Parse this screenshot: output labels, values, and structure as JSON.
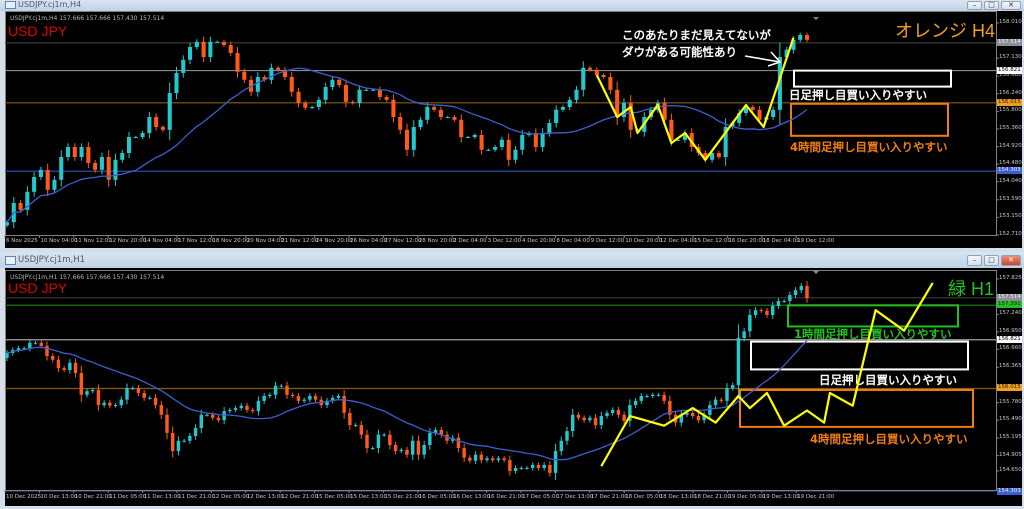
{
  "windows": [
    {
      "title": "USDJPY.cj1m,H4",
      "header": "USDJPY.cj1m,H4  157.666 157.666 157.430 157.514",
      "symbol_label": "USD JPY",
      "timeframe_label": "オレンジ H4",
      "controls": {
        "minimize": "–",
        "maximize": "□",
        "close": "✕"
      }
    },
    {
      "title": "USDJPY.cj1m,H1",
      "header": "USDJPY.cj1m,H1  157.666 157.666 157.430 157.514",
      "symbol_label": "USD JPY",
      "timeframe_label": "緑 H1",
      "controls": {
        "minimize": "–",
        "maximize": "□",
        "close": "✕"
      }
    }
  ],
  "colors": {
    "bull": "#22c8cc",
    "bear": "#ff5a1a",
    "ma": "#3b5fd0",
    "zigzag": "#ffff00",
    "orange": "#f07d10",
    "green": "#22c020",
    "white": "#ffffff",
    "symbol": "#e00000",
    "h4_label": "#f0a020",
    "h1_label": "#22c020"
  },
  "chart_data": [
    {
      "type": "candlestick",
      "title": "USD JPY",
      "timeframe": "H4",
      "ylim": [
        152.71,
        158.01
      ],
      "x_tick_labels": [
        "6 Nov 2025",
        "10 Nov 04:00",
        "11 Nov 12:00",
        "12 Nov 20:00",
        "14 Nov 04:00",
        "17 Nov 12:00",
        "18 Nov 20:00",
        "20 Nov 04:00",
        "21 Nov 12:00",
        "24 Nov 20:00",
        "26 Nov 04:00",
        "27 Nov 12:00",
        "28 Nov 20:00",
        "2 Dec 04:00",
        "3 Dec 12:00",
        "4 Dec 20:00",
        "8 Dec 04:00",
        "9 Dec 12:00",
        "10 Dec 20:00",
        "12 Dec 04:00",
        "15 Dec 12:00",
        "16 Dec 20:00",
        "18 Dec 04:00",
        "19 Dec 12:00"
      ],
      "y_tick_labels": [
        "158.010",
        "157.130",
        "156.680",
        "156.240",
        "155.800",
        "155.360",
        "154.920",
        "154.480",
        "154.040",
        "153.590",
        "153.150",
        "152.710"
      ],
      "price_markers": [
        {
          "price": 157.514,
          "label": "157.514",
          "color": "#8a8f99",
          "line": "#3a3a3a"
        },
        {
          "price": 156.821,
          "label": "156.821",
          "color": "#ffffff",
          "line": "#8a8a8a"
        },
        {
          "price": 156.015,
          "label": "156.015",
          "color": "#f0a020",
          "line": "#8a5a10"
        },
        {
          "price": 154.303,
          "label": "154.303",
          "color": "#3b5fd0",
          "line": "#2a4aa0"
        }
      ],
      "closes": [
        153.03,
        153.51,
        153.34,
        153.79,
        154.16,
        154.34,
        153.84,
        154.09,
        154.66,
        154.91,
        154.66,
        154.91,
        154.51,
        154.34,
        154.66,
        154.09,
        154.59,
        154.76,
        155.16,
        155.16,
        155.26,
        155.66,
        155.41,
        155.34,
        156.26,
        156.76,
        157.09,
        157.41,
        157.54,
        157.16,
        157.54,
        157.54,
        157.46,
        157.26,
        156.79,
        156.59,
        156.29,
        156.66,
        156.59,
        156.89,
        156.84,
        156.66,
        156.29,
        156.01,
        155.89,
        155.91,
        156.09,
        156.41,
        156.59,
        156.46,
        156.04,
        156.01,
        156.34,
        156.34,
        156.34,
        156.16,
        156.09,
        155.66,
        155.34,
        154.84,
        155.41,
        155.59,
        155.91,
        155.84,
        155.66,
        155.66,
        155.59,
        155.16,
        155.16,
        155.21,
        154.84,
        154.84,
        154.91,
        155.09,
        154.59,
        154.84,
        155.21,
        155.26,
        154.91,
        155.26,
        155.51,
        155.84,
        155.91,
        156.09,
        156.34,
        156.89,
        156.84,
        156.71,
        156.66,
        156.34,
        155.66,
        156.01,
        155.34,
        155.29,
        155.66,
        155.84,
        156.01,
        155.59,
        155.09,
        155.09,
        155.26,
        154.91,
        154.76,
        154.59,
        154.76,
        154.66,
        155.41,
        155.51,
        155.76,
        155.91,
        155.84,
        155.59,
        155.66,
        155.84,
        157.16,
        157.34,
        157.59,
        157.71,
        157.59
      ],
      "zigzag": [
        [
          87,
          156.71
        ],
        [
          90,
          155.66
        ],
        [
          92,
          155.91
        ],
        [
          93,
          155.26
        ],
        [
          96,
          155.96
        ],
        [
          98,
          155.01
        ],
        [
          100,
          155.26
        ],
        [
          103,
          154.59
        ],
        [
          109,
          155.96
        ],
        [
          111.6,
          155.41
        ],
        [
          116,
          157.64
        ]
      ],
      "zones": [
        {
          "label": "日足押し目買い入りやすい",
          "top": 156.82,
          "bottom": 156.42,
          "color": "#ffffff"
        },
        {
          "label": "4時間足押し目買い入りやすい",
          "top": 155.99,
          "bottom": 155.19,
          "color": "#f07d10"
        }
      ],
      "annotation": {
        "lines": [
          "このあたりまだ見えてないが",
          "ダウがある可能性あり"
        ]
      }
    },
    {
      "type": "candlestick",
      "title": "USD JPY",
      "timeframe": "H1",
      "ylim": [
        154.303,
        157.825
      ],
      "x_tick_labels": [
        "10 Dec 2025",
        "10 Dec 13:00",
        "10 Dec 21:00",
        "11 Dec 05:00",
        "11 Dec 13:00",
        "11 Dec 21:00",
        "12 Dec 05:00",
        "12 Dec 13:00",
        "12 Dec 21:00",
        "15 Dec 05:00",
        "15 Dec 13:00",
        "15 Dec 21:00",
        "16 Dec 05:00",
        "16 Dec 13:00",
        "16 Dec 21:00",
        "17 Dec 05:00",
        "17 Dec 13:00",
        "17 Dec 21:00",
        "18 Dec 05:00",
        "18 Dec 13:00",
        "18 Dec 21:00",
        "19 Dec 05:00",
        "19 Dec 13:00",
        "19 Dec 21:00"
      ],
      "y_tick_labels": [
        "157.825",
        "157.240",
        "156.950",
        "156.660",
        "156.365",
        "155.780",
        "155.490",
        "155.195",
        "154.905",
        "154.650"
      ],
      "price_markers": [
        {
          "price": 157.514,
          "label": "157.514",
          "color": "#8a8f99",
          "line": "#3a3a3a"
        },
        {
          "price": 157.391,
          "label": "157.391",
          "color": "#22c020",
          "line": "#1a7a1a"
        },
        {
          "price": 156.821,
          "label": "156.821",
          "color": "#ffffff",
          "line": "#a0a0a0"
        },
        {
          "price": 156.015,
          "label": "156.015",
          "color": "#f0a020",
          "line": "#8a5a10"
        },
        {
          "price": 154.303,
          "label": "154.303",
          "color": "#3b5fd0",
          "line": "#2a4aa0"
        }
      ],
      "closes": [
        156.6,
        156.65,
        156.68,
        156.68,
        156.77,
        156.77,
        156.72,
        156.55,
        156.49,
        156.35,
        156.32,
        156.44,
        156.27,
        155.91,
        155.97,
        155.99,
        155.74,
        155.78,
        155.73,
        155.74,
        155.83,
        156.02,
        156.02,
        155.94,
        155.86,
        155.86,
        155.74,
        155.58,
        155.28,
        154.98,
        155.15,
        155.15,
        155.23,
        155.36,
        155.58,
        155.58,
        155.53,
        155.49,
        155.64,
        155.66,
        155.69,
        155.73,
        155.66,
        155.64,
        155.81,
        155.89,
        155.91,
        156.06,
        156.06,
        155.91,
        155.89,
        155.81,
        155.83,
        155.89,
        155.83,
        155.74,
        155.81,
        155.86,
        155.89,
        155.61,
        155.41,
        155.41,
        155.25,
        155.03,
        155.03,
        155.25,
        155.25,
        155.08,
        154.98,
        155.0,
        154.92,
        155.15,
        154.92,
        155.08,
        155.28,
        155.33,
        155.25,
        155.15,
        155.2,
        155.03,
        154.87,
        154.82,
        154.92,
        154.83,
        154.86,
        154.83,
        154.86,
        154.83,
        154.65,
        154.7,
        154.7,
        154.7,
        154.75,
        154.7,
        154.75,
        154.62,
        154.98,
        155.15,
        155.31,
        155.58,
        155.53,
        155.49,
        155.53,
        155.41,
        155.56,
        155.61,
        155.66,
        155.58,
        155.48,
        155.74,
        155.81,
        155.89,
        155.89,
        155.91,
        155.91,
        155.81,
        155.58,
        155.45,
        155.58,
        155.61,
        155.56,
        155.49,
        155.58,
        155.74,
        155.83,
        155.81,
        156.02,
        156.07,
        156.85,
        156.96,
        157.23,
        157.31,
        157.3,
        157.23,
        157.38,
        157.46,
        157.46,
        157.56,
        157.64,
        157.71,
        157.51
      ],
      "zigzag": [
        [
          104,
          154.73
        ],
        [
          109,
          155.56
        ],
        [
          115,
          155.4
        ],
        [
          120,
          155.69
        ],
        [
          124,
          155.45
        ],
        [
          128,
          155.89
        ],
        [
          130,
          155.69
        ],
        [
          133,
          155.94
        ],
        [
          136,
          155.4
        ],
        [
          140,
          155.65
        ],
        [
          143,
          155.45
        ],
        [
          144,
          155.94
        ],
        [
          148,
          155.73
        ],
        [
          152,
          157.31
        ],
        [
          157,
          156.97
        ],
        [
          162,
          157.76
        ]
      ],
      "zones": [
        {
          "label": "1時間足押し目買い入りやすい",
          "top": 157.39,
          "bottom": 157.04,
          "color": "#22c020"
        },
        {
          "label": "日足押し目買い入りやすい",
          "top": 156.79,
          "bottom": 156.33,
          "color": "#ffffff"
        },
        {
          "label": "4時間足押し目買い入りやすい",
          "top": 155.99,
          "bottom": 155.38,
          "color": "#f07d10"
        }
      ]
    }
  ]
}
